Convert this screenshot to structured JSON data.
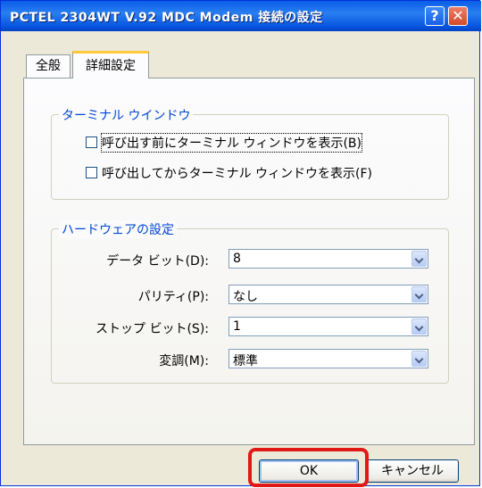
{
  "window": {
    "title": "PCTEL 2304WT V.92 MDC Modem 接続の設定",
    "help_label": "?",
    "close_label": "✕"
  },
  "tabs": [
    {
      "label": "全般",
      "selected": false
    },
    {
      "label": "詳細設定",
      "selected": true
    }
  ],
  "terminal_group": {
    "title": "ターミナル ウインドウ",
    "options": [
      {
        "label": "呼び出す前にターミナル ウィンドウを表示(B)",
        "checked": false
      },
      {
        "label": "呼び出してからターミナル ウィンドウを表示(F)",
        "checked": false
      }
    ]
  },
  "hardware_group": {
    "title": "ハードウェアの設定",
    "fields": [
      {
        "label": "データ ビット(D):",
        "value": "8"
      },
      {
        "label": "パリティ(P):",
        "value": "なし"
      },
      {
        "label": "ストップ ビット(S):",
        "value": "1"
      },
      {
        "label": "変調(M):",
        "value": "標準"
      }
    ]
  },
  "buttons": {
    "ok_label": "OK",
    "cancel_label": "キャンセル"
  },
  "colors": {
    "titlebar": "#0a5ee8",
    "group_title": "#0046d5",
    "highlight": "#e01818"
  }
}
